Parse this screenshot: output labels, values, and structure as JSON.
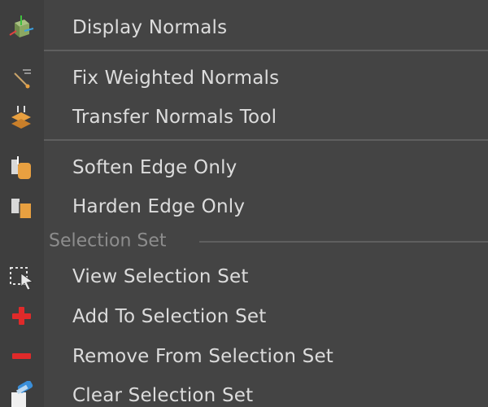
{
  "menu": {
    "items": [
      {
        "label": "Display Normals",
        "icon": "display-normals-icon"
      },
      {
        "label": "Fix Weighted Normals",
        "icon": "fix-weighted-normals-icon"
      },
      {
        "label": "Transfer Normals Tool",
        "icon": "transfer-normals-icon"
      },
      {
        "label": "Soften Edge Only",
        "icon": "soften-edge-icon"
      },
      {
        "label": "Harden Edge Only",
        "icon": "harden-edge-icon"
      }
    ],
    "section": {
      "label": "Selection Set"
    },
    "selection_items": [
      {
        "label": "View Selection Set",
        "icon": "view-selection-set-icon"
      },
      {
        "label": "Add To Selection Set",
        "icon": "add-icon"
      },
      {
        "label": "Remove From Selection Set",
        "icon": "remove-icon"
      },
      {
        "label": "Clear Selection Set",
        "icon": "clear-selection-set-icon"
      }
    ]
  },
  "colors": {
    "background": "#444444",
    "text": "#dcdcdc",
    "section_text": "#8d8d8d",
    "divider": "#5f5f5f",
    "accent_red": "#e02a2a",
    "accent_orange": "#e8a040"
  }
}
